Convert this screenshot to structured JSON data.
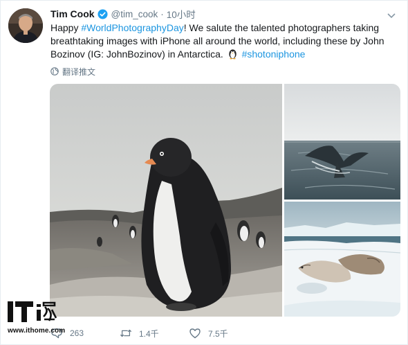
{
  "tweet": {
    "author_name": "Tim Cook",
    "handle": "@tim_cook",
    "separator": "·",
    "time": "10小时",
    "text_prefix": "Happy ",
    "hashtag_photography": "#WorldPhotographyDay",
    "text_body": "! We salute the talented photographers taking breathtaking images with iPhone all around the world, including these by John Bozinov (IG: JohnBozinov) in Antarctica. ",
    "hashtag_iphone": "#shotoniphone",
    "translate_label": "翻译推文"
  },
  "media": {
    "images": [
      "penguin-photo",
      "whale-tail-photo",
      "seals-on-ice-photo"
    ]
  },
  "actions": {
    "reply_count": "263",
    "retweet_count": "1.4千",
    "like_count": "7.5千"
  },
  "watermark": {
    "url": "www.ithome.com"
  },
  "colors": {
    "link": "#1b95e0",
    "secondary_text": "#657786",
    "verified": "#1da1f2"
  },
  "icons": [
    "verified-badge-icon",
    "chevron-down-icon",
    "globe-icon",
    "penguin-emoji-icon",
    "reply-icon",
    "retweet-icon",
    "like-icon",
    "ithome-logo-icon"
  ]
}
